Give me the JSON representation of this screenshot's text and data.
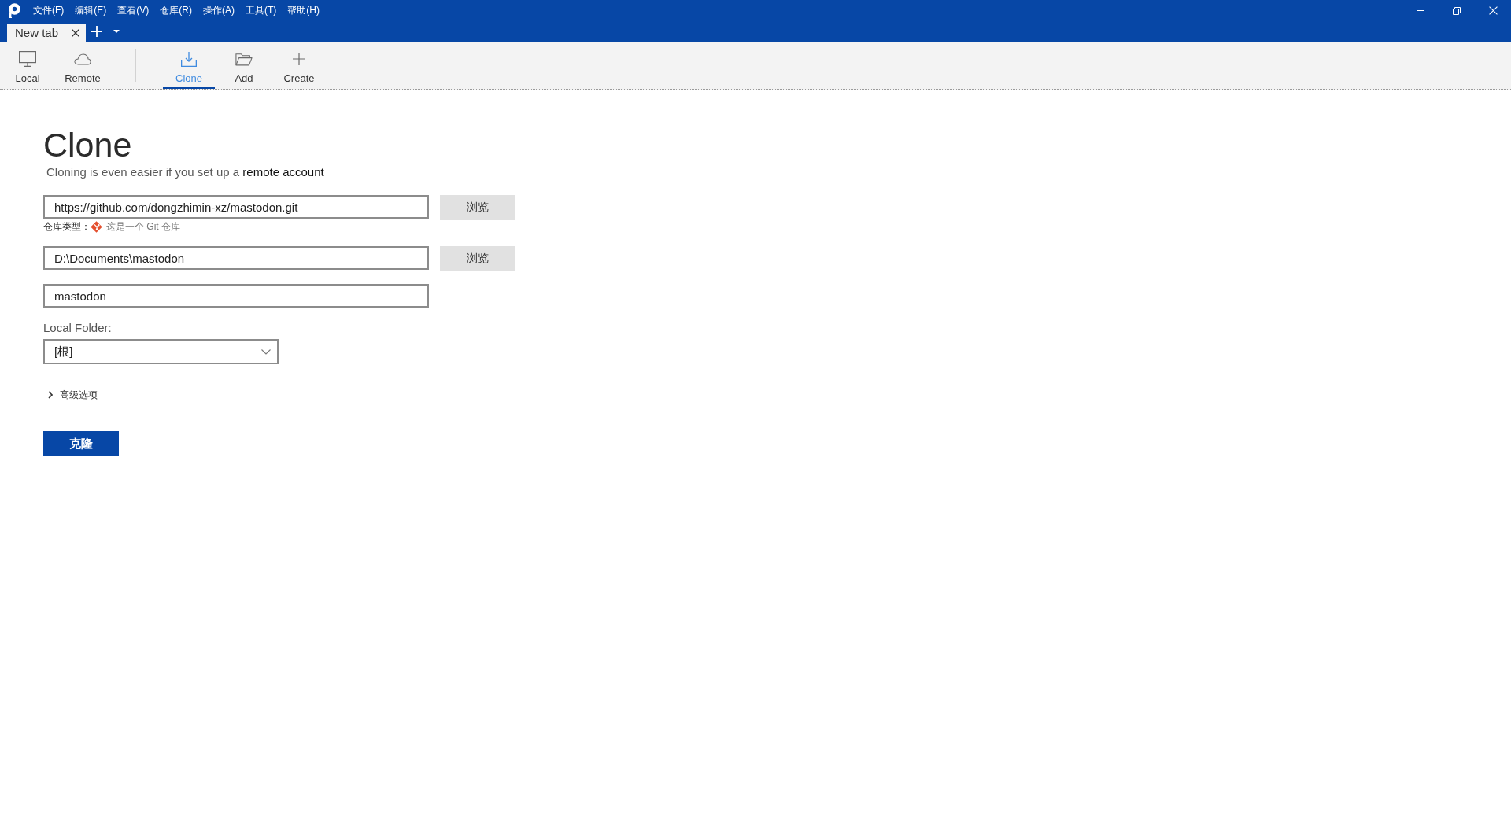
{
  "menu": [
    "文件(F)",
    "编辑(E)",
    "查看(V)",
    "仓库(R)",
    "操作(A)",
    "工具(T)",
    "帮助(H)"
  ],
  "tabs": [
    {
      "label": "New tab",
      "selected": true
    }
  ],
  "toolbar": {
    "groups": [
      {
        "items": [
          {
            "label": "Local",
            "selected": false
          },
          {
            "label": "Remote",
            "selected": false
          }
        ]
      },
      {
        "items": [
          {
            "label": "Clone",
            "selected": true
          },
          {
            "label": "Add",
            "selected": false
          },
          {
            "label": "Create",
            "selected": false
          }
        ]
      }
    ]
  },
  "page": {
    "title": "Clone",
    "subtitle": "Cloning is even easier if you set up a",
    "subtitle_link": "remote account"
  },
  "source": {
    "value": "https://github.com/dongzhimin-xz/mastodon.git",
    "button": "浏览",
    "repo_type_label": "仓库类型：",
    "repo_type": "这是一个 Git 仓库"
  },
  "destination": {
    "value": "D:\\Documents\\mastodon",
    "button": "浏览"
  },
  "name": {
    "value": "mastodon"
  },
  "local_folder": {
    "label": "Local Folder:",
    "value": "[根]"
  },
  "advanced": {
    "label": "高级选项",
    "expanded": false
  },
  "submit": {
    "label": "克隆"
  }
}
